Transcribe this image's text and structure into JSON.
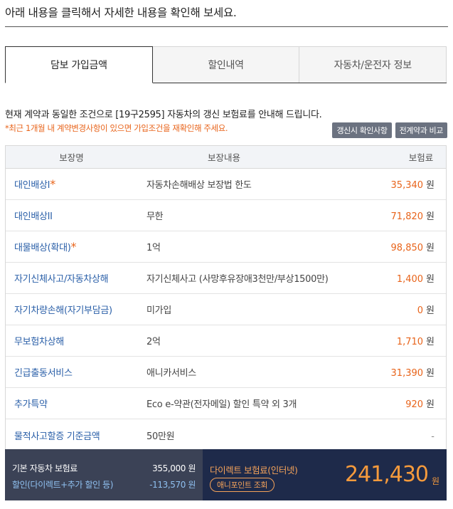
{
  "header": {
    "title": "아래 내용을 클릭해서 자세한 내용을 확인해 보세요."
  },
  "tabs": [
    {
      "label": "담보 가입금액",
      "active": true
    },
    {
      "label": "할인내역",
      "active": false
    },
    {
      "label": "자동차/운전자 정보",
      "active": false
    }
  ],
  "intro": "현재 계약과 동일한 조건으로 [19구2595] 자동차의 갱신 보험료를 안내해 드립니다.",
  "notice": "*최근 1개월 내 계약변경사항이 있으면 가입조건을 재확인해 주세요.",
  "buttons": {
    "renew_check": "갱신시 확인사항",
    "compare": "전계약과 비교"
  },
  "table": {
    "headers": {
      "name": "보장명",
      "detail": "보장내용",
      "premium": "보험료"
    },
    "unit": "원",
    "rows": [
      {
        "name": "대인배상I",
        "star": "*",
        "detail": "자동차손해배상 보장법 한도",
        "premium": "35,340"
      },
      {
        "name": "대인배상II",
        "star": "",
        "detail": "무한",
        "premium": "71,820"
      },
      {
        "name": "대물배상(확대)",
        "star": "*",
        "detail": "1억",
        "premium": "98,850"
      },
      {
        "name": "자기신체사고/자동차상해",
        "star": "",
        "detail": "자기신체사고 (사망후유장애3천만/부상1500만)",
        "premium": "1,400"
      },
      {
        "name": "자기차량손해(자기부담금)",
        "star": "",
        "detail": "미가입",
        "premium": "0"
      },
      {
        "name": "무보험차상해",
        "star": "",
        "detail": "2억",
        "premium": "1,710"
      },
      {
        "name": "긴급출동서비스",
        "star": "",
        "detail": "애니카서비스",
        "premium": "31,390"
      },
      {
        "name": "추가특약",
        "star": "",
        "detail": "Eco e-약관(전자메일) 할인 특약 외 3개",
        "premium": "920"
      },
      {
        "name": "물적사고할증 기준금액",
        "star": "",
        "detail": "50만원",
        "premium": "-"
      }
    ]
  },
  "summary": {
    "base_label": "기본 자동차 보험료",
    "base_value": "355,000 원",
    "discount_label": "할인(다이렉트+추가 할인 등)",
    "discount_value": "-113,570 원",
    "direct_label": "다이렉트 보험료(인터넷)",
    "anipoint_label": "애니포인트 조회",
    "total": "241,430",
    "total_unit": "원"
  },
  "colors": {
    "accent": "#e8641b",
    "link": "#2a5fa8",
    "summary_left": "#3b4256",
    "summary_right": "#1e2a4a"
  }
}
